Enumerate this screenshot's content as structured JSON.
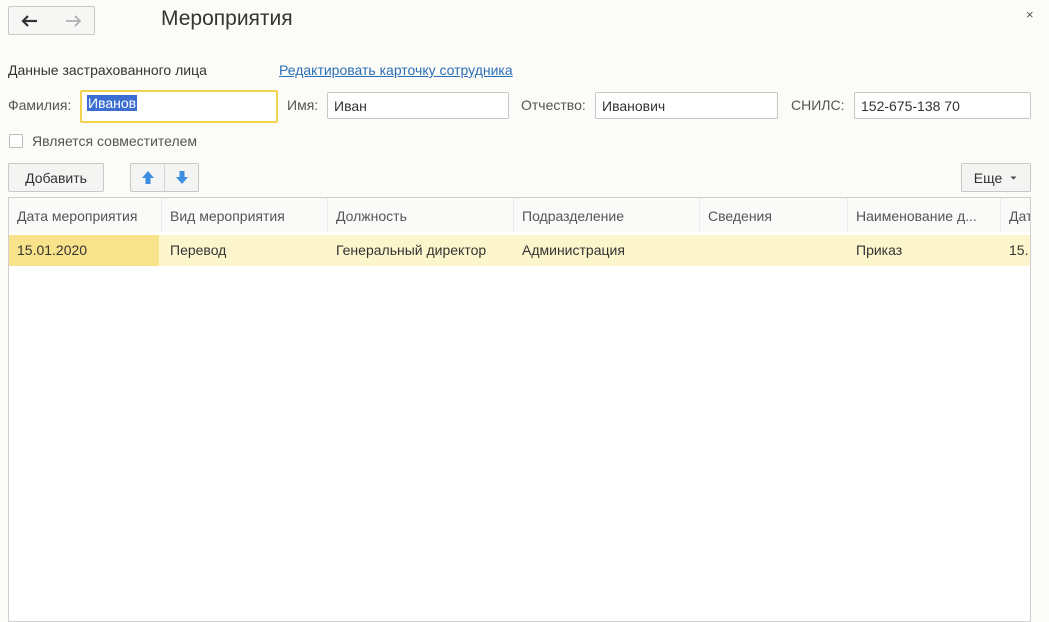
{
  "window": {
    "title": "Мероприятия",
    "close_label": "×",
    "nav": {
      "back_icon": "arrow-left-icon",
      "forward_icon": "arrow-right-icon"
    }
  },
  "insured_person": {
    "section_label": "Данные застрахованного лица",
    "edit_link": "Редактировать карточку сотрудника",
    "surname_label": "Фамилия:",
    "surname_value": "Иванов",
    "name_label": "Имя:",
    "name_value": "Иван",
    "patronymic_label": "Отчество:",
    "patronymic_value": "Иванович",
    "snils_label": "СНИЛС:",
    "snils_value": "152-675-138 70",
    "part_time_label": "Является совместителем",
    "part_time_checked": false
  },
  "toolbar": {
    "add_label": "Добавить",
    "move_up_icon": "arrow-up-icon",
    "move_down_icon": "arrow-down-icon",
    "more_label": "Еще",
    "more_icon": "chevron-down-icon"
  },
  "table": {
    "columns": [
      "Дата мероприятия",
      "Вид мероприятия",
      "Должность",
      "Подразделение",
      "Сведения",
      "Наименование д...",
      "Дат"
    ],
    "rows": [
      [
        "15.01.2020",
        "Перевод",
        "Генеральный директор",
        "Администрация",
        "",
        "Приказ",
        "15."
      ]
    ]
  },
  "colors": {
    "link": "#2d6fb8",
    "focus_border": "#f3d250",
    "row_highlight": "#fdf6cc",
    "current_cell": "#f9e38a",
    "text_selection": "#3b6ed0",
    "arrow_blue": "#3d8ee0"
  }
}
